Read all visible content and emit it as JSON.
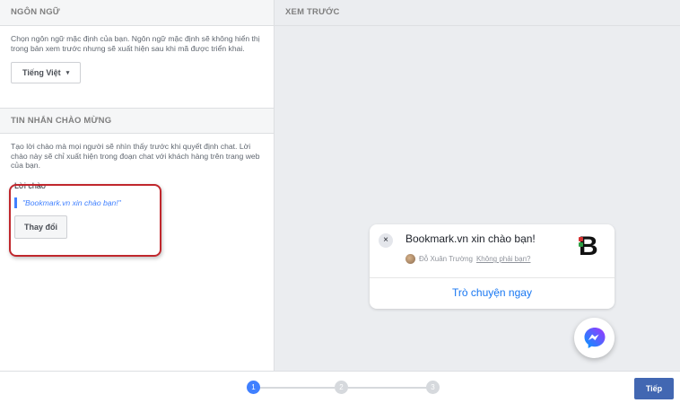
{
  "language_section": {
    "header": "NGÔN NGỮ",
    "description": "Chọn ngôn ngữ mặc định của bạn. Ngôn ngữ mặc định sẽ không hiển thị trong bản xem trước nhưng sẽ xuất hiện sau khi mã được triển khai.",
    "selected_language": "Tiếng Việt",
    "caret": "▾"
  },
  "welcome_section": {
    "header": "TIN NHẮN CHÀO MỪNG",
    "description": "Tạo lời chào mà mọi người sẽ nhìn thấy trước khi quyết định chat. Lời chào này sẽ chỉ xuất hiện trong đoạn chat với khách hàng trên trang web của bạn.",
    "greeting_label": "Lời chào",
    "greeting_text": "\"Bookmark.vn xin chào bạn!\"",
    "change_button": "Thay đổi"
  },
  "preview": {
    "header": "XEM TRƯỚC",
    "close_symbol": "×",
    "title": "Bookmark.vn xin chào bạn!",
    "user_name": "Đỗ Xuân Trường",
    "not_you": "Không phải bạn?",
    "brand_letter": "B",
    "chat_now": "Trò chuyện ngay"
  },
  "footer": {
    "steps": [
      "1",
      "2",
      "3"
    ],
    "active_step": 1,
    "next_button": "Tiếp"
  },
  "colors": {
    "accent": "#4080ff",
    "primary_button": "#4267b2",
    "highlight": "#c0272d",
    "messenger_gradient_start": "#0099ff",
    "messenger_gradient_end": "#a033ff"
  },
  "icons": [
    "close-icon",
    "caret-down-icon",
    "messenger-icon",
    "avatar",
    "brand-logo"
  ]
}
